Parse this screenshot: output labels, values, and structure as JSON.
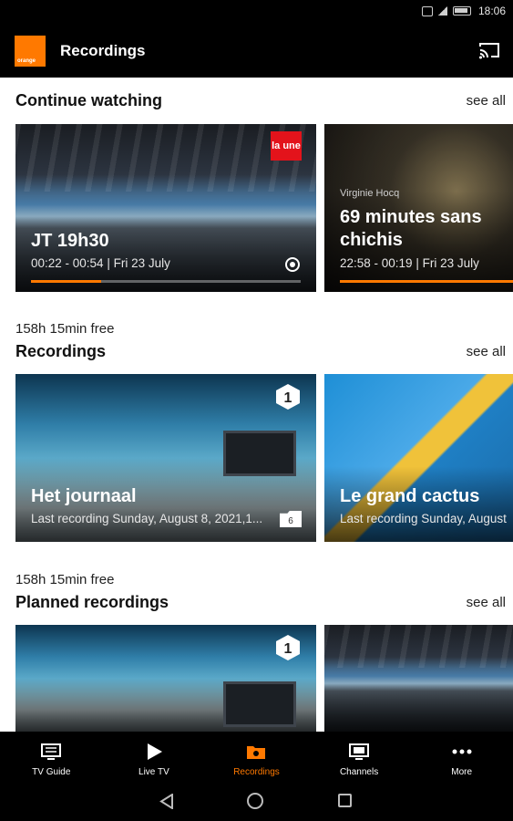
{
  "status_bar": {
    "time": "18:06"
  },
  "app_bar": {
    "logo_text": "orange",
    "title": "Recordings"
  },
  "continue_watching": {
    "title": "Continue watching",
    "see_all": "see all",
    "cards": [
      {
        "title": "JT 19h30",
        "time": "00:22 - 00:54 | Fri 23 July",
        "channel_badge": "la une",
        "progress": 0.26
      },
      {
        "kicker": "Virginie Hocq",
        "title": "69 minutes sans chichis",
        "time": "22:58 - 00:19 | Fri 23 July",
        "progress": 1.0
      }
    ]
  },
  "recordings": {
    "free_space": "158h 15min free",
    "title": "Recordings",
    "see_all": "see all",
    "cards": [
      {
        "title": "Het journaal",
        "subtitle": "Last recording Sunday, August 8, 2021,1...",
        "count": "6"
      },
      {
        "title": "Le grand cactus",
        "subtitle": "Last recording Sunday, August"
      }
    ]
  },
  "planned_recordings": {
    "free_space": "158h 15min free",
    "title": "Planned recordings",
    "see_all": "see all"
  },
  "bottom_nav": [
    {
      "label": "TV Guide",
      "icon": "tv-guide-icon"
    },
    {
      "label": "Live TV",
      "icon": "play-icon"
    },
    {
      "label": "Recordings",
      "icon": "recordings-folder-icon",
      "active": true
    },
    {
      "label": "Channels",
      "icon": "channels-icon"
    },
    {
      "label": "More",
      "icon": "more-dots-icon"
    }
  ],
  "colors": {
    "accent": "#ff7900",
    "bar": "#000000",
    "background": "#ffffff"
  }
}
